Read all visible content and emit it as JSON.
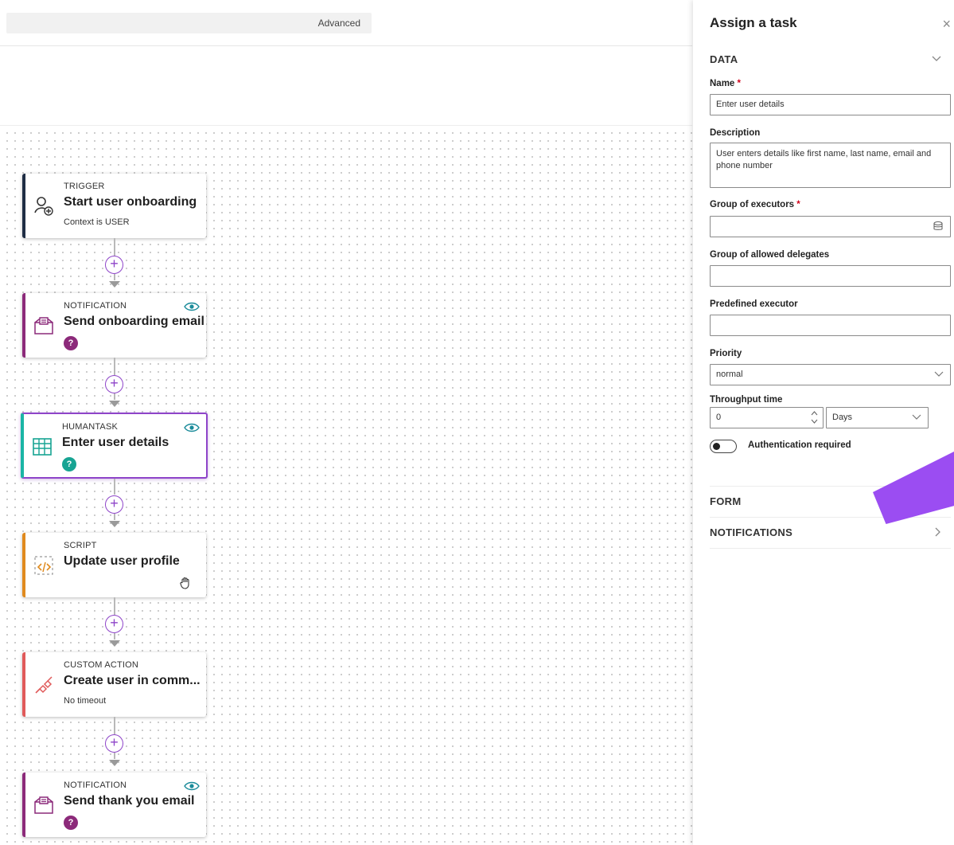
{
  "toolbar": {
    "mode_label": "Advanced"
  },
  "canvas": {
    "nodes": [
      {
        "type": "TRIGGER",
        "title": "Start user onboarding",
        "subtitle": "Context is USER",
        "accent": "#1f2d44"
      },
      {
        "type": "NOTIFICATION",
        "title": "Send onboarding email",
        "badge": "?",
        "badge_color": "#8c2a7a",
        "accent": "#8c2a7a",
        "icon": "mail-folder-icon",
        "has_eye": true
      },
      {
        "type": "HUMANTASK",
        "title": "Enter user details",
        "badge": "?",
        "badge_color": "#17a493",
        "accent": "#1bb5a5",
        "icon": "table-icon",
        "has_eye": true,
        "selected": true
      },
      {
        "type": "SCRIPT",
        "title": "Update user profile",
        "accent": "#e08a1e",
        "icon": "script-icon"
      },
      {
        "type": "CUSTOM ACTION",
        "title": "Create user in comm...",
        "subtitle": "No timeout",
        "accent": "#e05a5a",
        "icon": "plug-icon"
      },
      {
        "type": "NOTIFICATION",
        "title": "Send thank you email",
        "badge": "?",
        "badge_color": "#8c2a7a",
        "accent": "#8c2a7a",
        "icon": "mail-folder-icon",
        "has_eye": true
      }
    ],
    "plus_symbol": "+"
  },
  "panel": {
    "title": "Assign a task",
    "close_symbol": "×",
    "sections": {
      "data": "DATA",
      "form": "FORM",
      "notifications": "NOTIFICATIONS"
    },
    "fields": {
      "name_label": "Name",
      "name_value": "Enter user details",
      "description_label": "Description",
      "description_value": "User enters details like first name, last name, email and phone number",
      "group_executors_label": "Group of executors",
      "group_delegates_label": "Group of allowed delegates",
      "predefined_executor_label": "Predefined executor",
      "priority_label": "Priority",
      "priority_value": "normal",
      "throughput_label": "Throughput time",
      "throughput_value": "0",
      "throughput_unit": "Days",
      "auth_label": "Authentication required",
      "required_mark": "*"
    },
    "auth_toggle_on": false
  },
  "colors": {
    "accent_purple": "#8e44c9",
    "highlight": "#9b4df2"
  }
}
